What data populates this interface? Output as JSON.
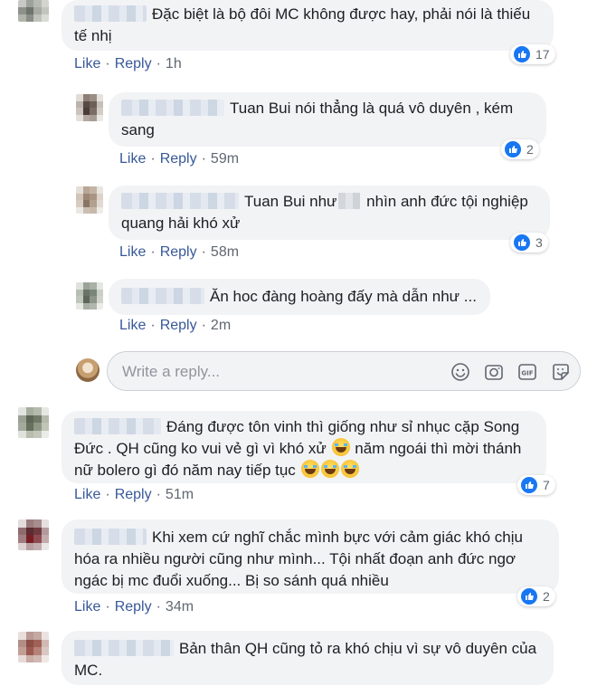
{
  "action_labels": {
    "like": "Like",
    "reply": "Reply"
  },
  "comments": [
    {
      "text": "Đặc biệt là bộ đôi MC không được hay, phải nói là thiếu tế nhị",
      "time": "1h",
      "reactions": "17"
    },
    {
      "text": "Tuan Bui nói thẳng là quá vô duyên , kém sang",
      "time": "59m",
      "reactions": "2"
    },
    {
      "text_a": "Tuan Bui như",
      "text_b": "nhìn anh đức tội nghiệp quang hải khó xử",
      "time": "58m",
      "reactions": "3"
    },
    {
      "text": "Ăn hoc đàng hoàng đấy mà dẫn như ...",
      "time": "2m"
    },
    {
      "text_a": "Đáng được tôn vinh thì giống như sỉ nhục cặp Song Đức . QH cũng ko vui vẻ gì vì khó xử",
      "text_b": "năm ngoái thì mời thánh nữ bolero gì đó năm nay tiếp tục",
      "time": "51m",
      "reactions": "7"
    },
    {
      "text": "Khi xem cứ nghĩ chắc mình bực với cảm giác khó chịu hóa ra nhiều người cũng như mình... Tội nhất đoạn anh đức ngơ ngác bị mc đuổi xuống... Bị so sánh quá nhiều",
      "time": "34m",
      "reactions": "2"
    },
    {
      "text": "Bản thân QH cũng tỏ ra khó chịu vì sự vô duyên của MC."
    }
  ],
  "reply_box": {
    "placeholder": "Write a reply...",
    "icons": [
      "smiley-icon",
      "camera-icon",
      "gif-icon",
      "sticker-icon"
    ]
  },
  "colors": {
    "link": "#385898",
    "bubble": "#f2f3f5",
    "like": "#1877f2"
  }
}
